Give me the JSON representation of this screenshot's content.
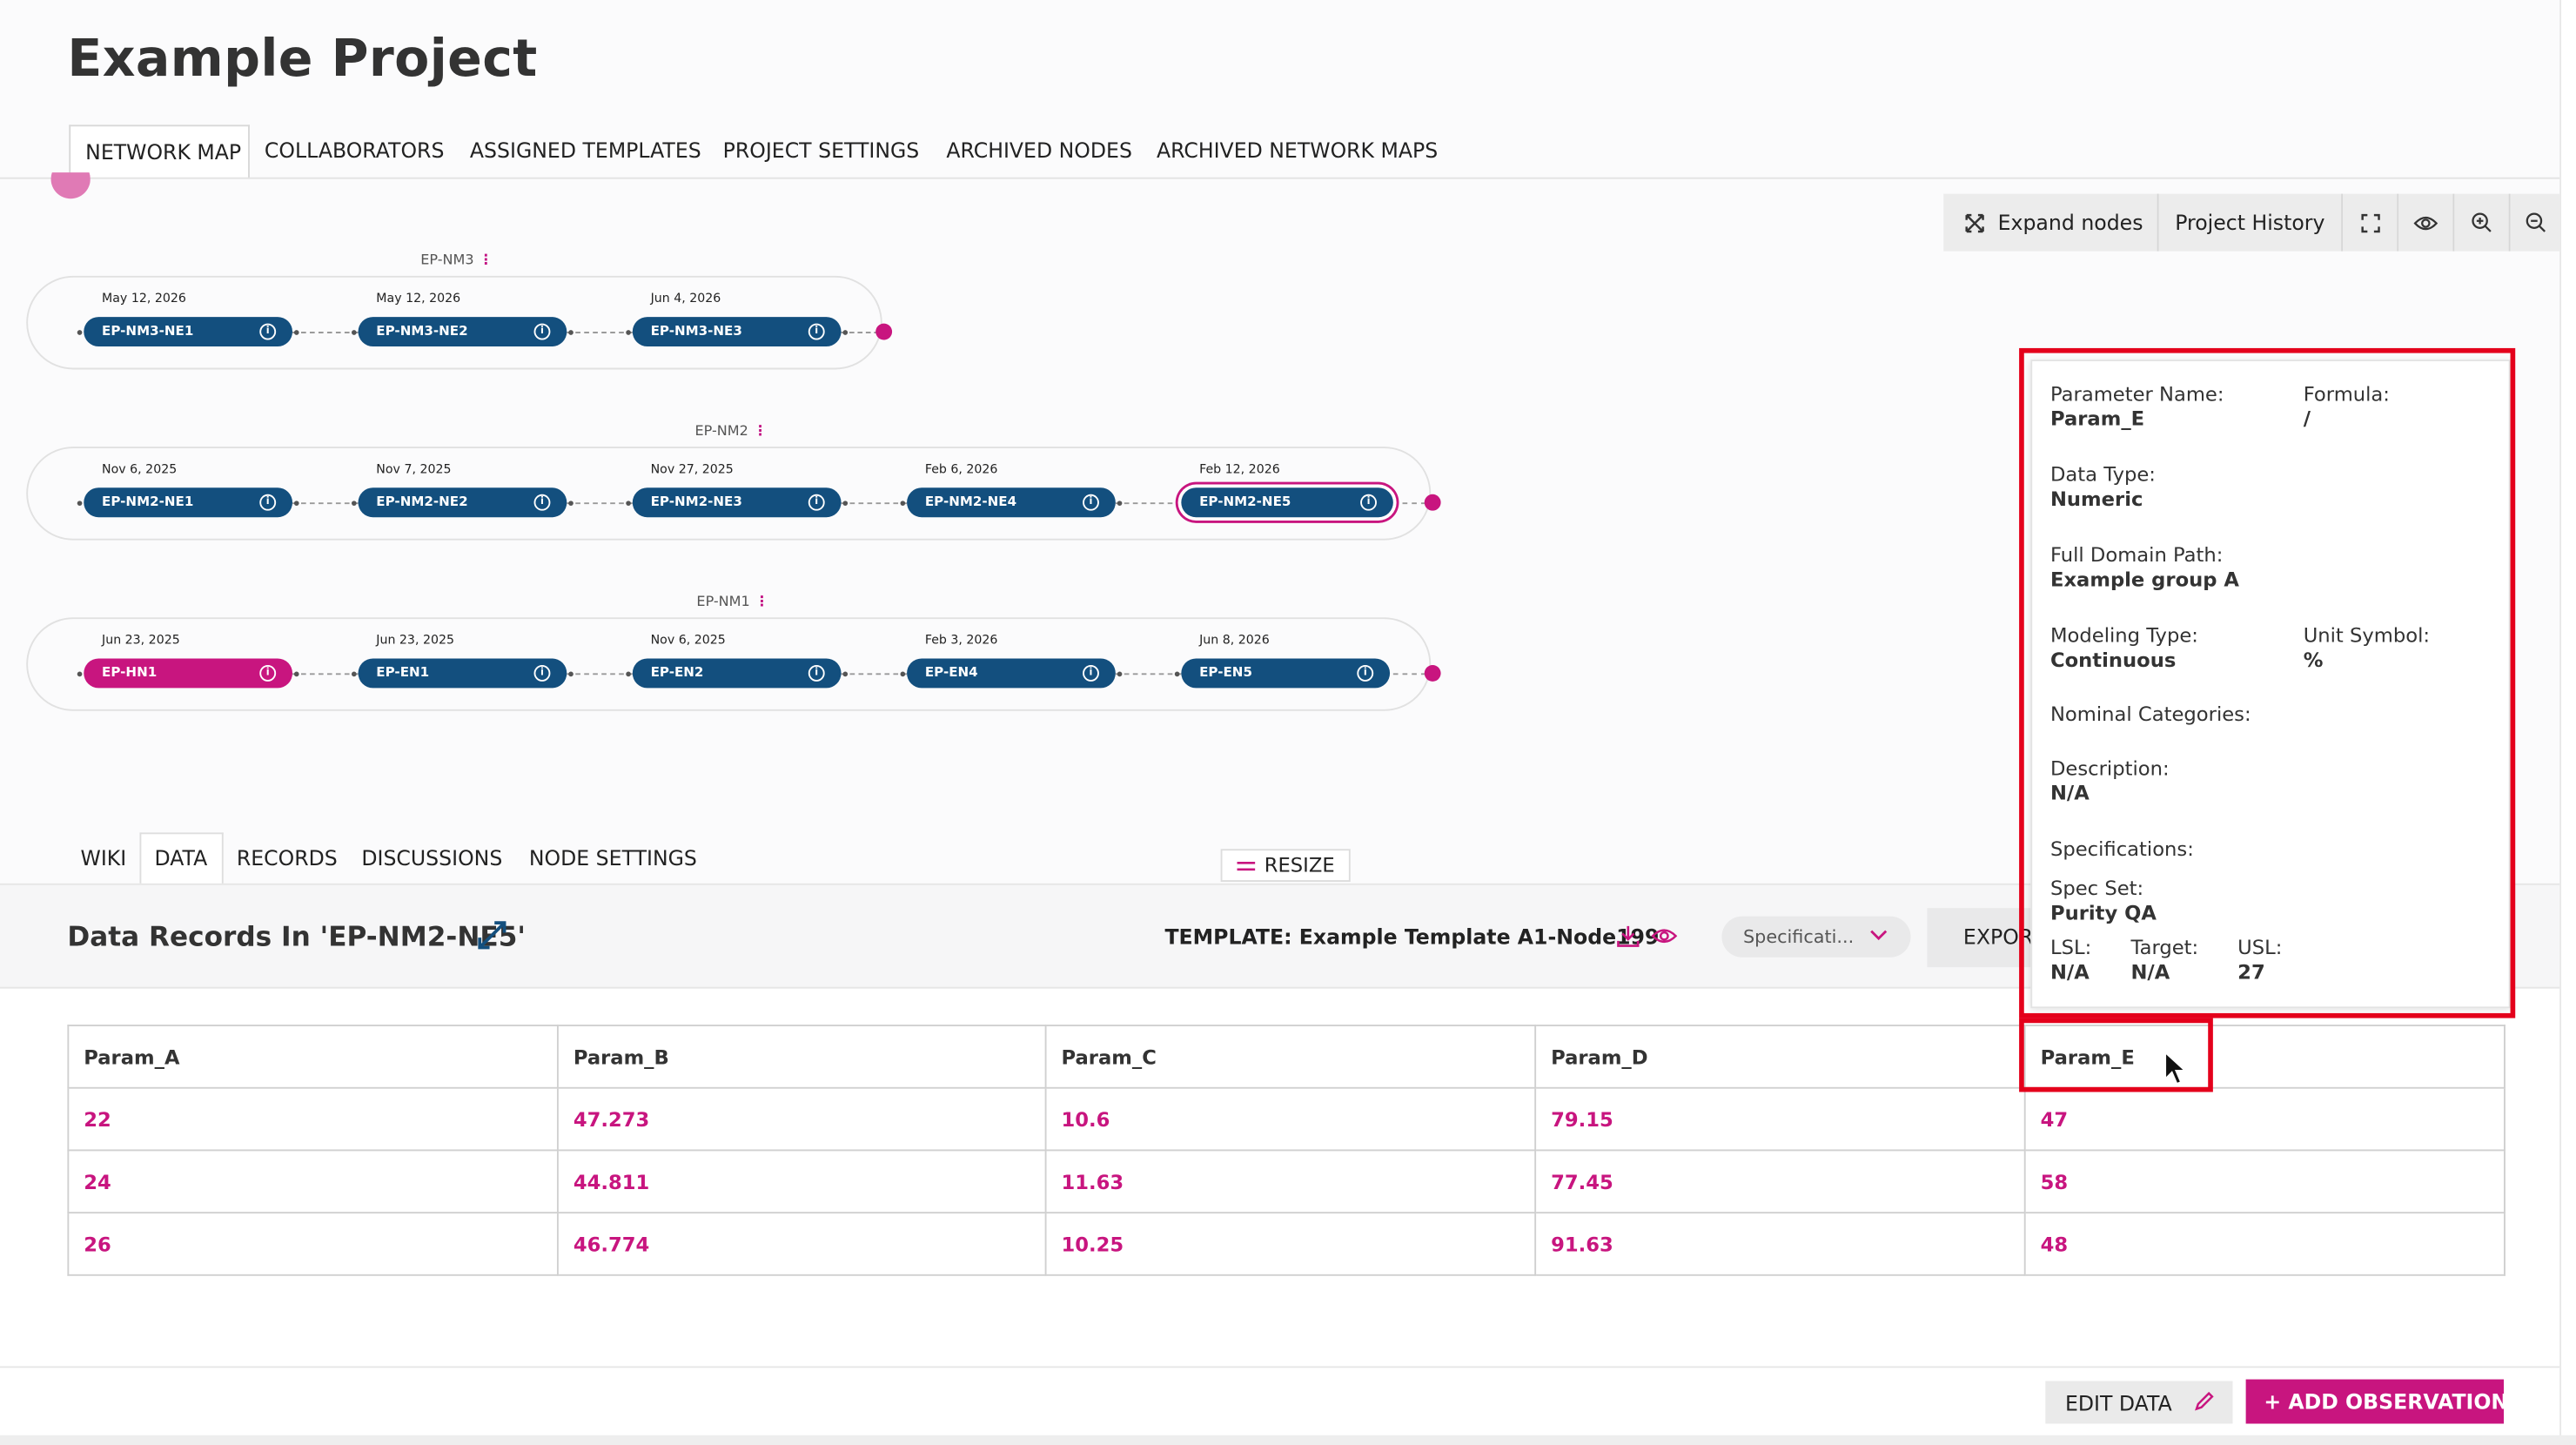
{
  "page": {
    "title": "Example Project"
  },
  "tabs": [
    "NETWORK MAP",
    "COLLABORATORS",
    "ASSIGNED TEMPLATES",
    "PROJECT SETTINGS",
    "ARCHIVED NODES",
    "ARCHIVED NETWORK MAPS"
  ],
  "toolbar": {
    "expand_label": "Expand nodes",
    "history_label": "Project History",
    "icons": [
      "fullscreen-icon",
      "eye-icon",
      "zoom-in-icon",
      "zoom-out-icon"
    ]
  },
  "network_maps": [
    {
      "name": "EP-NM3",
      "nodes": [
        {
          "date": "May 12, 2026",
          "label": "EP-NM3-NE1"
        },
        {
          "date": "May 12, 2026",
          "label": "EP-NM3-NE2"
        },
        {
          "date": "Jun 4, 2026",
          "label": "EP-NM3-NE3"
        }
      ]
    },
    {
      "name": "EP-NM2",
      "nodes": [
        {
          "date": "Nov 6, 2025",
          "label": "EP-NM2-NE1"
        },
        {
          "date": "Nov 7, 2025",
          "label": "EP-NM2-NE2"
        },
        {
          "date": "Nov 27, 2025",
          "label": "EP-NM2-NE3"
        },
        {
          "date": "Feb 6, 2026",
          "label": "EP-NM2-NE4"
        },
        {
          "date": "Feb 12, 2026",
          "label": "EP-NM2-NE5"
        }
      ]
    },
    {
      "name": "EP-NM1",
      "nodes": [
        {
          "date": "Jun 23, 2025",
          "label": "EP-HN1"
        },
        {
          "date": "Jun 23, 2025",
          "label": "EP-EN1"
        },
        {
          "date": "Nov 6, 2025",
          "label": "EP-EN2"
        },
        {
          "date": "Feb 3, 2026",
          "label": "EP-EN4"
        },
        {
          "date": "Jun 8, 2026",
          "label": "EP-EN5"
        }
      ]
    }
  ],
  "subtabs": [
    "WIKI",
    "DATA",
    "RECORDS",
    "DISCUSSIONS",
    "NODE SETTINGS"
  ],
  "resize_label": "RESIZE",
  "data_panel": {
    "title": "Data Records In 'EP-NM2-NE5'",
    "template_label": "TEMPLATE: Example Template A1-Node199",
    "spec_select": "Specificati...",
    "export_label": "EXPORT"
  },
  "table": {
    "headers": [
      "Param_A",
      "Param_B",
      "Param_C",
      "Param_D",
      "Param_E"
    ],
    "rows": [
      [
        "22",
        "47.273",
        "10.6",
        "79.15",
        "47"
      ],
      [
        "24",
        "44.811",
        "11.63",
        "77.45",
        "58"
      ],
      [
        "26",
        "46.774",
        "10.25",
        "91.63",
        "48"
      ]
    ]
  },
  "footer": {
    "edit_label": "EDIT DATA",
    "add_label": "+ ADD OBSERVATION"
  },
  "popup": {
    "param_name_label": "Parameter Name:",
    "param_name": "Param_E",
    "formula_label": "Formula:",
    "formula": "/",
    "data_type_label": "Data Type:",
    "data_type": "Numeric",
    "domain_path_label": "Full Domain Path:",
    "domain_path": "Example group A",
    "modeling_type_label": "Modeling Type:",
    "modeling_type": "Continuous",
    "unit_symbol_label": "Unit Symbol:",
    "unit_symbol": "%",
    "nominal_label": "Nominal Categories:",
    "description_label": "Description:",
    "description": "N/A",
    "specifications_label": "Specifications:",
    "spec_set_label": "Spec Set:",
    "spec_set": "Purity QA",
    "lsl_label": "LSL:",
    "lsl": "N/A",
    "target_label": "Target:",
    "target": "N/A",
    "usl_label": "USL:",
    "usl": "27"
  },
  "colors": {
    "accent": "#c8157f",
    "node_blue": "#134f7e",
    "highlight_red": "#e4001b"
  }
}
